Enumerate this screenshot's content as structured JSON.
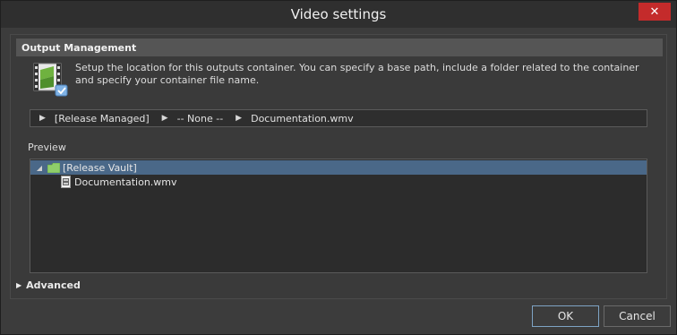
{
  "window": {
    "title": "Video settings"
  },
  "output_management": {
    "header": "Output Management",
    "description": "Setup the location for this outputs container. You can specify a base path, include a folder related to the container and specify your container file name."
  },
  "path": {
    "segments": [
      "[Release Managed]",
      "-- None --",
      "Documentation.wmv"
    ]
  },
  "preview": {
    "label": "Preview",
    "folder": "[Release Vault]",
    "file": "Documentation.wmv"
  },
  "advanced": {
    "label": "Advanced"
  },
  "buttons": {
    "ok": "OK",
    "cancel": "Cancel"
  },
  "colors": {
    "close": "#c42b2b",
    "selection": "#4a6888",
    "folder": "#8fce6a"
  }
}
